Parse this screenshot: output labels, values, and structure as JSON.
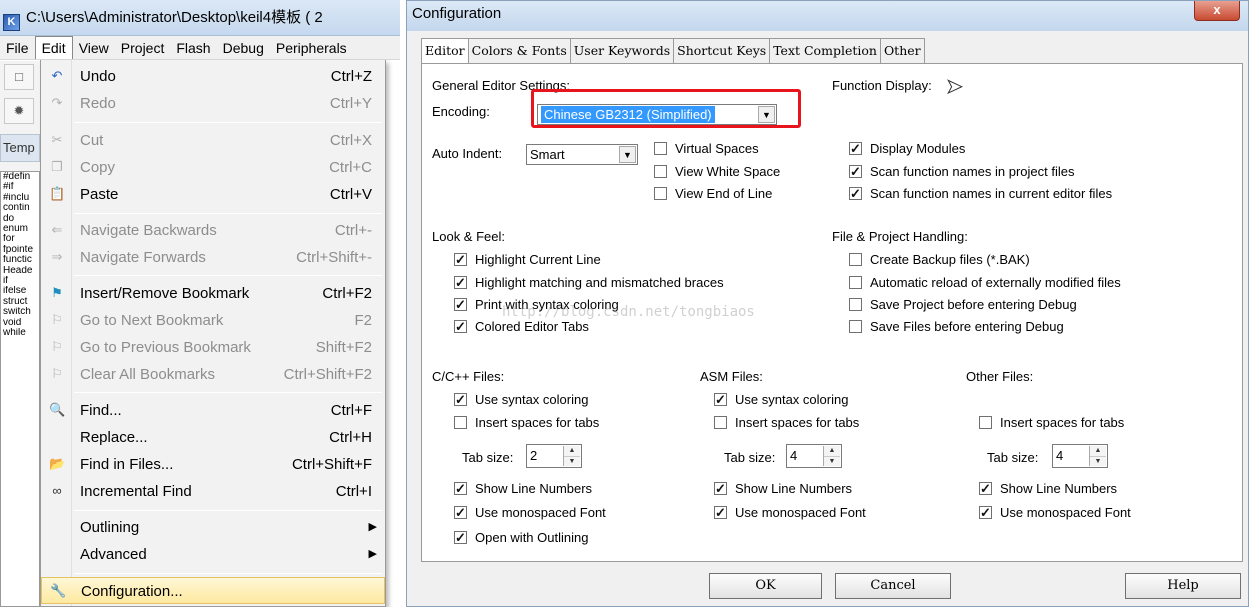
{
  "keil_window": {
    "title": "C:\\Users\\Administrator\\Desktop\\keil4模板 ( 2",
    "menubar": [
      "File",
      "Edit",
      "View",
      "Project",
      "Flash",
      "Debug",
      "Peripherals"
    ],
    "templates_tab": "Temp",
    "template_list": [
      "#defin",
      "#if",
      "#inclu",
      "contin",
      "do",
      "enum",
      "for",
      "fpointe",
      "functic",
      "Heade",
      "if",
      "ifelse",
      "struct",
      "switch",
      "void",
      "while"
    ]
  },
  "edit_menu": {
    "undo": {
      "label": "Undo",
      "shortcut": "Ctrl+Z"
    },
    "redo": {
      "label": "Redo",
      "shortcut": "Ctrl+Y"
    },
    "cut": {
      "label": "Cut",
      "shortcut": "Ctrl+X"
    },
    "copy": {
      "label": "Copy",
      "shortcut": "Ctrl+C"
    },
    "paste": {
      "label": "Paste",
      "shortcut": "Ctrl+V"
    },
    "nav_back": {
      "label": "Navigate Backwards",
      "shortcut": "Ctrl+-"
    },
    "nav_fwd": {
      "label": "Navigate Forwards",
      "shortcut": "Ctrl+Shift+-"
    },
    "bookmark": {
      "label": "Insert/Remove Bookmark",
      "shortcut": "Ctrl+F2"
    },
    "next_bm": {
      "label": "Go to Next Bookmark",
      "shortcut": "F2"
    },
    "prev_bm": {
      "label": "Go to Previous Bookmark",
      "shortcut": "Shift+F2"
    },
    "clear_bm": {
      "label": "Clear All Bookmarks",
      "shortcut": "Ctrl+Shift+F2"
    },
    "find": {
      "label": "Find...",
      "shortcut": "Ctrl+F"
    },
    "replace": {
      "label": "Replace...",
      "shortcut": "Ctrl+H"
    },
    "find_files": {
      "label": "Find in Files...",
      "shortcut": "Ctrl+Shift+F"
    },
    "inc_find": {
      "label": "Incremental Find",
      "shortcut": "Ctrl+I"
    },
    "outlining": {
      "label": "Outlining"
    },
    "advanced": {
      "label": "Advanced"
    },
    "configuration": {
      "label": "Configuration..."
    }
  },
  "config": {
    "title": "Configuration",
    "close_glyph": "x",
    "tabs": [
      "Editor",
      "Colors & Fonts",
      "User Keywords",
      "Shortcut Keys",
      "Text Completion",
      "Other"
    ],
    "active_tab": "Editor",
    "general": {
      "title": "General Editor Settings:",
      "encoding_label": "Encoding:",
      "encoding_value": "Chinese GB2312 (Simplified)",
      "auto_indent_label": "Auto Indent:",
      "auto_indent_value": "Smart",
      "virtual_spaces": "Virtual Spaces",
      "view_white_space": "View White Space",
      "view_end_of_line": "View End of Line"
    },
    "function_display": {
      "title": "Function Display:",
      "display_modules": "Display Modules",
      "scan_project": "Scan function names in project files",
      "scan_editor": "Scan function names in current editor files"
    },
    "look_feel": {
      "title": "Look & Feel:",
      "highlight_line": "Highlight Current Line",
      "highlight_braces": "Highlight matching and mismatched braces",
      "print_syntax": "Print with syntax coloring",
      "colored_tabs": "Colored Editor Tabs"
    },
    "file_project": {
      "title": "File & Project Handling:",
      "backup": "Create Backup files (*.BAK)",
      "auto_reload": "Automatic reload of externally modified files",
      "save_project": "Save Project before entering Debug",
      "save_files": "Save Files before entering Debug"
    },
    "cfiles": {
      "title": "C/C++ Files:",
      "syntax": "Use syntax coloring",
      "spaces": "Insert spaces for tabs",
      "tab_size_label": "Tab size:",
      "tab_size": "2",
      "line_numbers": "Show Line Numbers",
      "mono": "Use monospaced Font",
      "outlining": "Open with Outlining"
    },
    "asmfiles": {
      "title": "ASM Files:",
      "syntax": "Use syntax coloring",
      "spaces": "Insert spaces for tabs",
      "tab_size_label": "Tab size:",
      "tab_size": "4",
      "line_numbers": "Show Line Numbers",
      "mono": "Use monospaced Font"
    },
    "otherfiles": {
      "title": "Other Files:",
      "spaces": "Insert spaces for tabs",
      "tab_size_label": "Tab size:",
      "tab_size": "4",
      "line_numbers": "Show Line Numbers",
      "mono": "Use monospaced Font"
    },
    "watermark": "http://blog.csdn.net/tongbiaos",
    "buttons": {
      "ok": "OK",
      "cancel": "Cancel",
      "help": "Help"
    }
  },
  "colors": {
    "highlight_box": "#e8141c",
    "selection": "#3399ff"
  }
}
